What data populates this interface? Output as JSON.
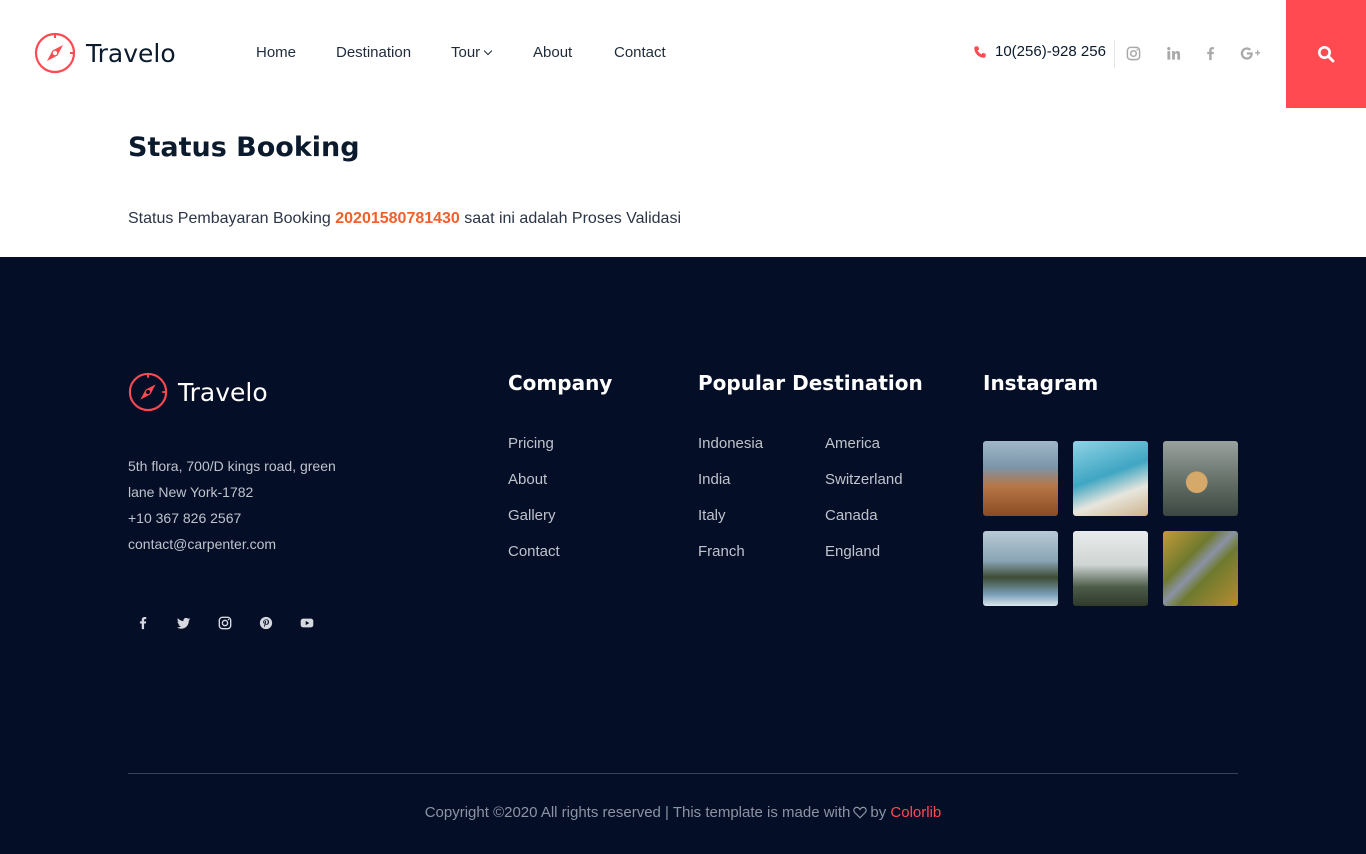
{
  "brand": {
    "name": "Travelo",
    "accent_color": "#ff4a52",
    "icon": "compass-icon"
  },
  "nav": {
    "items": [
      {
        "label": "Home"
      },
      {
        "label": "Destination"
      },
      {
        "label": "Tour",
        "has_dropdown": true
      },
      {
        "label": "About"
      },
      {
        "label": "Contact"
      }
    ]
  },
  "header": {
    "phone": "10(256)-928 256",
    "social_icons": [
      "instagram-icon",
      "linkedin-icon",
      "facebook-icon",
      "google-plus-icon"
    ],
    "search_icon": "search-icon"
  },
  "main": {
    "title": "Status Booking",
    "status_prefix": "Status Pembayaran Booking",
    "booking_code": "20201580781430",
    "status_suffix": "saat ini adalah Proses Validasi",
    "code_color": "#f15f2a"
  },
  "footer": {
    "background": "#040e27",
    "brand_name": "Travelo",
    "address_lines": [
      "5th flora, 700/D kings road, green",
      "lane New York-1782",
      "+10 367 826 2567",
      "contact@carpenter.com"
    ],
    "social_icons": [
      "facebook-icon",
      "twitter-icon",
      "instagram-icon",
      "pinterest-icon",
      "youtube-icon"
    ],
    "company": {
      "title": "Company",
      "links": [
        "Pricing",
        "About",
        "Gallery",
        "Contact"
      ]
    },
    "popular": {
      "title": "Popular Destination",
      "col1": [
        "Indonesia",
        "India",
        "Italy",
        "Franch"
      ],
      "col2": [
        "America",
        "Switzerland",
        "Canada",
        "England"
      ]
    },
    "instagram": {
      "title": "Instagram",
      "photos": [
        "mountain-river-photo",
        "beach-paraglider-photo",
        "woman-mountain-photo",
        "temple-sea-photo",
        "misty-forest-photo",
        "forest-road-photo"
      ]
    },
    "copyright_prefix": "Copyright ©2020 All rights reserved | This template is made with",
    "copyright_by": "by",
    "copyright_brand": "Colorlib"
  }
}
